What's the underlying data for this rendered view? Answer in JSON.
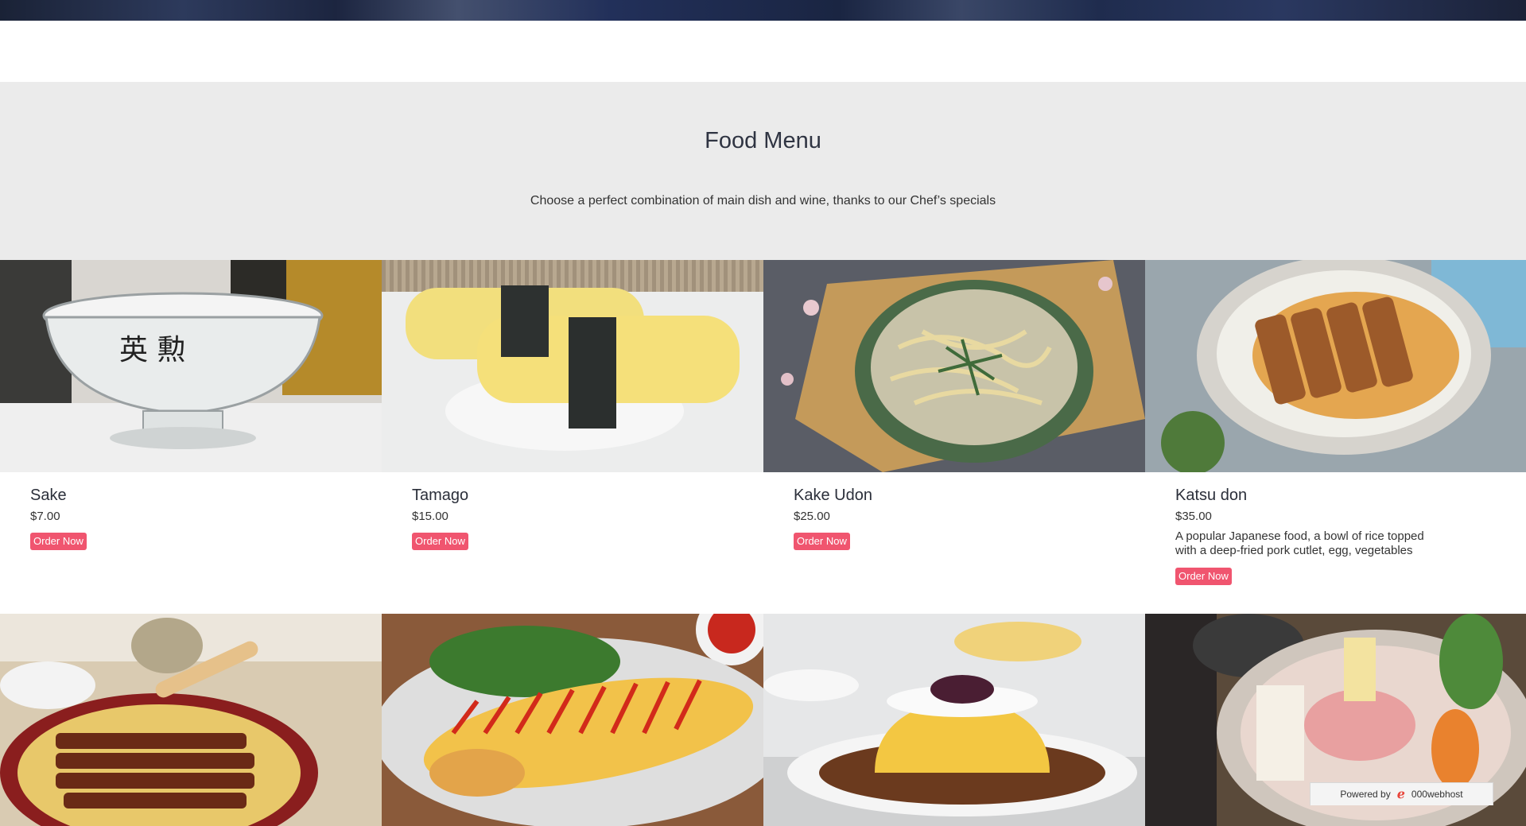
{
  "header": {
    "title": "Food Menu",
    "subtitle": "Choose a perfect combination of main dish and wine, thanks to our Chef’s specials"
  },
  "items": [
    {
      "name": "Sake",
      "price": "$7.00",
      "description": "",
      "button": "Order Now"
    },
    {
      "name": "Tamago",
      "price": "$15.00",
      "description": "",
      "button": "Order Now"
    },
    {
      "name": "Kake Udon",
      "price": "$25.00",
      "description": "",
      "button": "Order Now"
    },
    {
      "name": "Katsu don",
      "price": "$35.00",
      "description": "A popular Japanese food, a bowl of rice topped with a deep-fried pork cutlet, egg, vegetables",
      "button": "Order Now"
    }
  ],
  "footer_badge": {
    "label": "Powered by",
    "brand": "000webhost"
  },
  "colors": {
    "accent": "#f0556f",
    "section_bg": "#ebebeb",
    "text": "#2b2f3a"
  }
}
